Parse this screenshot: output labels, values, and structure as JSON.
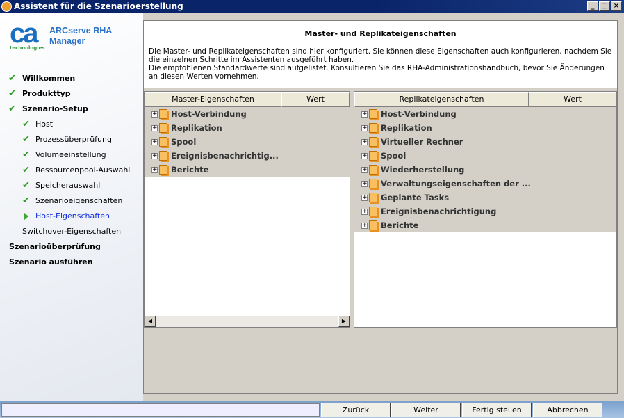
{
  "window": {
    "title": "Assistent für die Szenarioerstellung",
    "min": "_",
    "max": "□",
    "close": "×"
  },
  "brand": {
    "logo": "ca",
    "logo_sub": "technologies",
    "product_line1": "ARCserve RHA",
    "product_line2": "Manager"
  },
  "sidebar": {
    "items": [
      {
        "label": "Willkommen",
        "state": "done",
        "level": 0
      },
      {
        "label": "Produkttyp",
        "state": "done",
        "level": 0
      },
      {
        "label": "Szenario-Setup",
        "state": "done",
        "level": 0
      },
      {
        "label": "Host",
        "state": "done",
        "level": 1
      },
      {
        "label": "Prozessüberprüfung",
        "state": "done",
        "level": 1
      },
      {
        "label": "Volumeeinstellung",
        "state": "done",
        "level": 1
      },
      {
        "label": "Ressourcenpool-Auswahl",
        "state": "done",
        "level": 1
      },
      {
        "label": "Speicherauswahl",
        "state": "done",
        "level": 1
      },
      {
        "label": "Szenarioeigenschaften",
        "state": "done",
        "level": 1
      },
      {
        "label": "Host-Eigenschaften",
        "state": "current",
        "level": 1
      },
      {
        "label": "Switchover-Eigenschaften",
        "state": "pending",
        "level": 1
      },
      {
        "label": "Szenarioüberprüfung",
        "state": "pending",
        "level": 0
      },
      {
        "label": "Szenario ausführen",
        "state": "pending",
        "level": 0
      }
    ]
  },
  "main": {
    "title": "Master- und Replikateigenschaften",
    "desc1": "Die Master- und Replikateigenschaften sind hier konfiguriert. Sie können diese Eigenschaften auch konfigurieren, nachdem Sie die einzelnen Schritte im Assistenten ausgeführt haben.",
    "desc2": "Die empfohlenen Standardwerte sind aufgelistet. Konsultieren Sie das RHA-Administrationshandbuch, bevor Sie Änderungen an diesen Werten vornehmen.",
    "master": {
      "col1": "Master-Eigenschaften",
      "col2": "Wert",
      "rows": [
        "Host-Verbindung",
        "Replikation",
        "Spool",
        "Ereignisbenachrichtig...",
        "Berichte"
      ]
    },
    "replica": {
      "col1": "Replikateigenschaften",
      "col2": "Wert",
      "rows": [
        "Host-Verbindung",
        "Replikation",
        "Virtueller Rechner",
        "Spool",
        "Wiederherstellung",
        "Verwaltungseigenschaften der ...",
        "Geplante Tasks",
        "Ereignisbenachrichtigung",
        "Berichte"
      ]
    }
  },
  "footer": {
    "back": "Zurück",
    "next": "Weiter",
    "finish": "Fertig stellen",
    "cancel": "Abbrechen",
    "status": ""
  }
}
